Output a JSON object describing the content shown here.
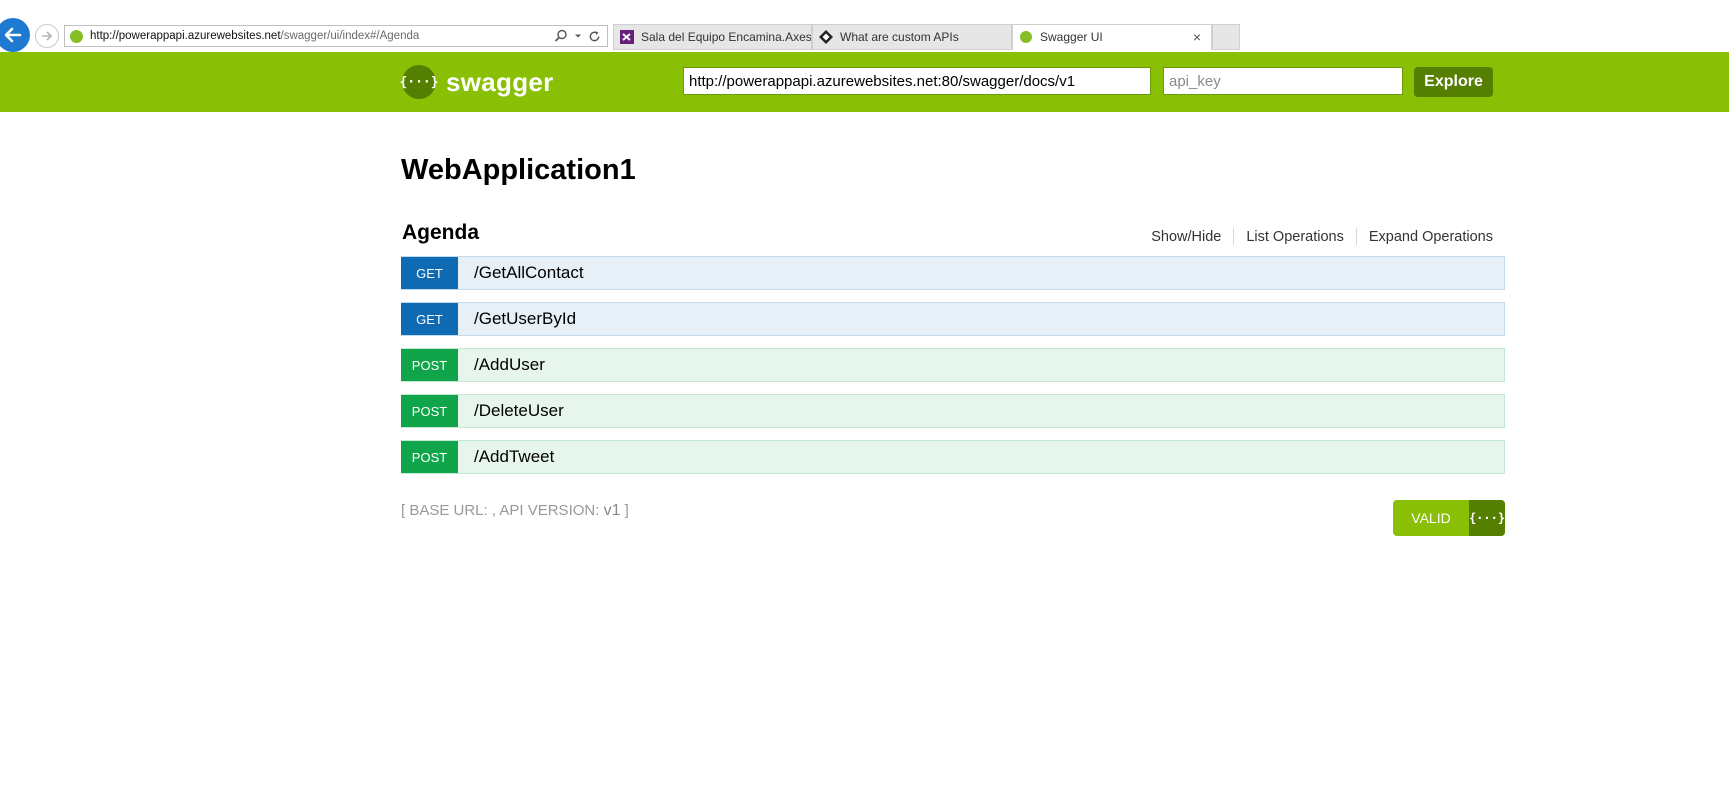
{
  "browser": {
    "address": {
      "host": "http://powerappapi.azurewebsites.net",
      "path": "/swagger/ui/index#/Agenda"
    },
    "tabs": [
      {
        "title": "Sala del Equipo Encamina.Axes...",
        "icon": "visual-studio-icon",
        "active": false
      },
      {
        "title": "What are custom APIs",
        "icon": "diamond-logo-icon",
        "active": false
      },
      {
        "title": "Swagger UI",
        "icon": "swagger-favicon-icon",
        "active": true,
        "close": "×"
      }
    ]
  },
  "header": {
    "logo_symbol": "{···}",
    "logo_text": "swagger",
    "url_value": "http://powerappapi.azurewebsites.net:80/swagger/docs/v1",
    "api_key_placeholder": "api_key",
    "explore_label": "Explore",
    "colors": {
      "bar": "#89bf04",
      "dark": "#547f00"
    }
  },
  "main": {
    "title": "WebApplication1",
    "resource": {
      "name": "Agenda",
      "actions": [
        "Show/Hide",
        "List Operations",
        "Expand Operations"
      ],
      "operations": [
        {
          "method": "GET",
          "path": "/GetAllContact"
        },
        {
          "method": "GET",
          "path": "/GetUserById"
        },
        {
          "method": "POST",
          "path": "/AddUser"
        },
        {
          "method": "POST",
          "path": "/DeleteUser"
        },
        {
          "method": "POST",
          "path": "/AddTweet"
        }
      ]
    },
    "footer": {
      "prefix": "[ BASE URL: , API VERSION: ",
      "version": "v1",
      "suffix": " ]"
    },
    "validator": {
      "label": "VALID",
      "symbol": "{···}"
    }
  }
}
